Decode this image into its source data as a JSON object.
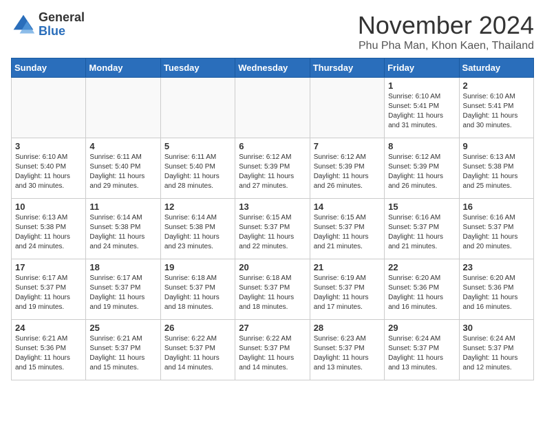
{
  "header": {
    "logo_general": "General",
    "logo_blue": "Blue",
    "month_title": "November 2024",
    "subtitle": "Phu Pha Man, Khon Kaen, Thailand"
  },
  "days_of_week": [
    "Sunday",
    "Monday",
    "Tuesday",
    "Wednesday",
    "Thursday",
    "Friday",
    "Saturday"
  ],
  "weeks": [
    [
      {
        "day": "",
        "info": ""
      },
      {
        "day": "",
        "info": ""
      },
      {
        "day": "",
        "info": ""
      },
      {
        "day": "",
        "info": ""
      },
      {
        "day": "",
        "info": ""
      },
      {
        "day": "1",
        "info": "Sunrise: 6:10 AM\nSunset: 5:41 PM\nDaylight: 11 hours and 31 minutes."
      },
      {
        "day": "2",
        "info": "Sunrise: 6:10 AM\nSunset: 5:41 PM\nDaylight: 11 hours and 30 minutes."
      }
    ],
    [
      {
        "day": "3",
        "info": "Sunrise: 6:10 AM\nSunset: 5:40 PM\nDaylight: 11 hours and 30 minutes."
      },
      {
        "day": "4",
        "info": "Sunrise: 6:11 AM\nSunset: 5:40 PM\nDaylight: 11 hours and 29 minutes."
      },
      {
        "day": "5",
        "info": "Sunrise: 6:11 AM\nSunset: 5:40 PM\nDaylight: 11 hours and 28 minutes."
      },
      {
        "day": "6",
        "info": "Sunrise: 6:12 AM\nSunset: 5:39 PM\nDaylight: 11 hours and 27 minutes."
      },
      {
        "day": "7",
        "info": "Sunrise: 6:12 AM\nSunset: 5:39 PM\nDaylight: 11 hours and 26 minutes."
      },
      {
        "day": "8",
        "info": "Sunrise: 6:12 AM\nSunset: 5:39 PM\nDaylight: 11 hours and 26 minutes."
      },
      {
        "day": "9",
        "info": "Sunrise: 6:13 AM\nSunset: 5:38 PM\nDaylight: 11 hours and 25 minutes."
      }
    ],
    [
      {
        "day": "10",
        "info": "Sunrise: 6:13 AM\nSunset: 5:38 PM\nDaylight: 11 hours and 24 minutes."
      },
      {
        "day": "11",
        "info": "Sunrise: 6:14 AM\nSunset: 5:38 PM\nDaylight: 11 hours and 24 minutes."
      },
      {
        "day": "12",
        "info": "Sunrise: 6:14 AM\nSunset: 5:38 PM\nDaylight: 11 hours and 23 minutes."
      },
      {
        "day": "13",
        "info": "Sunrise: 6:15 AM\nSunset: 5:37 PM\nDaylight: 11 hours and 22 minutes."
      },
      {
        "day": "14",
        "info": "Sunrise: 6:15 AM\nSunset: 5:37 PM\nDaylight: 11 hours and 21 minutes."
      },
      {
        "day": "15",
        "info": "Sunrise: 6:16 AM\nSunset: 5:37 PM\nDaylight: 11 hours and 21 minutes."
      },
      {
        "day": "16",
        "info": "Sunrise: 6:16 AM\nSunset: 5:37 PM\nDaylight: 11 hours and 20 minutes."
      }
    ],
    [
      {
        "day": "17",
        "info": "Sunrise: 6:17 AM\nSunset: 5:37 PM\nDaylight: 11 hours and 19 minutes."
      },
      {
        "day": "18",
        "info": "Sunrise: 6:17 AM\nSunset: 5:37 PM\nDaylight: 11 hours and 19 minutes."
      },
      {
        "day": "19",
        "info": "Sunrise: 6:18 AM\nSunset: 5:37 PM\nDaylight: 11 hours and 18 minutes."
      },
      {
        "day": "20",
        "info": "Sunrise: 6:18 AM\nSunset: 5:37 PM\nDaylight: 11 hours and 18 minutes."
      },
      {
        "day": "21",
        "info": "Sunrise: 6:19 AM\nSunset: 5:37 PM\nDaylight: 11 hours and 17 minutes."
      },
      {
        "day": "22",
        "info": "Sunrise: 6:20 AM\nSunset: 5:36 PM\nDaylight: 11 hours and 16 minutes."
      },
      {
        "day": "23",
        "info": "Sunrise: 6:20 AM\nSunset: 5:36 PM\nDaylight: 11 hours and 16 minutes."
      }
    ],
    [
      {
        "day": "24",
        "info": "Sunrise: 6:21 AM\nSunset: 5:36 PM\nDaylight: 11 hours and 15 minutes."
      },
      {
        "day": "25",
        "info": "Sunrise: 6:21 AM\nSunset: 5:37 PM\nDaylight: 11 hours and 15 minutes."
      },
      {
        "day": "26",
        "info": "Sunrise: 6:22 AM\nSunset: 5:37 PM\nDaylight: 11 hours and 14 minutes."
      },
      {
        "day": "27",
        "info": "Sunrise: 6:22 AM\nSunset: 5:37 PM\nDaylight: 11 hours and 14 minutes."
      },
      {
        "day": "28",
        "info": "Sunrise: 6:23 AM\nSunset: 5:37 PM\nDaylight: 11 hours and 13 minutes."
      },
      {
        "day": "29",
        "info": "Sunrise: 6:24 AM\nSunset: 5:37 PM\nDaylight: 11 hours and 13 minutes."
      },
      {
        "day": "30",
        "info": "Sunrise: 6:24 AM\nSunset: 5:37 PM\nDaylight: 11 hours and 12 minutes."
      }
    ]
  ]
}
